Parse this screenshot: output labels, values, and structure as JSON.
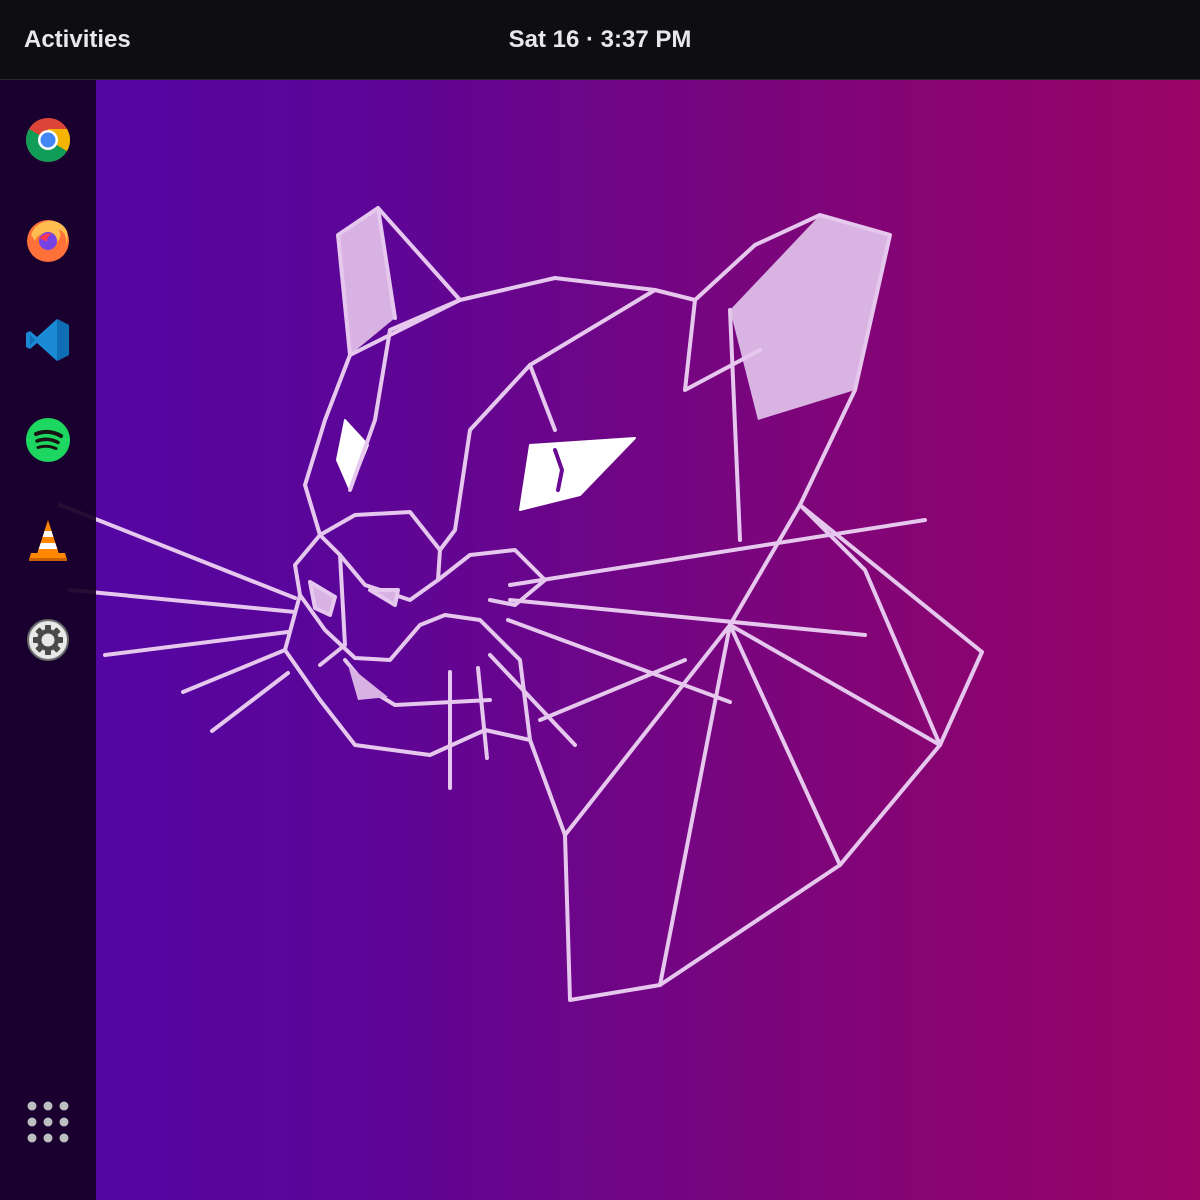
{
  "topbar": {
    "activities_label": "Activities",
    "clock_text": "Sat 16 · 3:37 PM"
  },
  "dock": {
    "items": [
      {
        "name": "chrome",
        "icon": "chrome-icon"
      },
      {
        "name": "firefox",
        "icon": "firefox-icon"
      },
      {
        "name": "vscode",
        "icon": "vscode-icon"
      },
      {
        "name": "spotify",
        "icon": "spotify-icon"
      },
      {
        "name": "vlc",
        "icon": "vlc-icon"
      },
      {
        "name": "settings",
        "icon": "settings-icon"
      }
    ],
    "show_apps_icon": "apps-grid-icon"
  },
  "wallpaper": {
    "subject": "geometric-cat-outline",
    "colors": {
      "gradient_left": "#5205a6",
      "gradient_right": "#9a0566",
      "line": "#e6c8ee"
    }
  }
}
